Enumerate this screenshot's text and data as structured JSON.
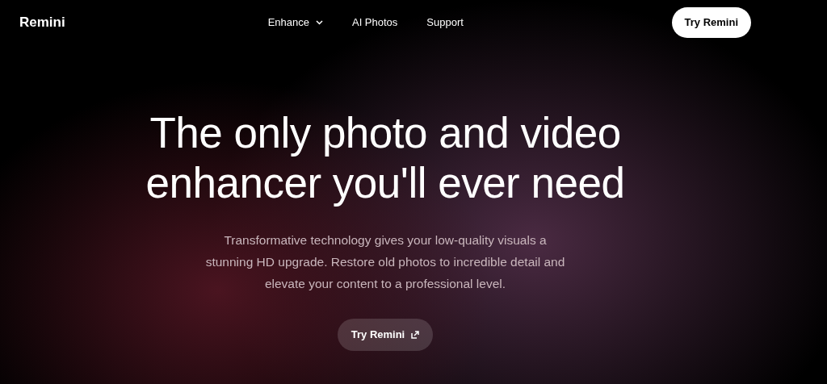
{
  "header": {
    "logo": "Remini",
    "nav": [
      {
        "label": "Enhance",
        "dropdown": true
      },
      {
        "label": "AI Photos",
        "dropdown": false
      },
      {
        "label": "Support",
        "dropdown": false
      }
    ],
    "cta": "Try Remini"
  },
  "hero": {
    "headline_lines": [
      "The only photo and video",
      "enhancer you'll ever need"
    ],
    "description_lines": [
      "Transformative technology gives your low-quality visuals a",
      "stunning HD upgrade. Restore old photos to incredible detail and",
      "elevate your content to a professional level."
    ],
    "button": {
      "label": "Try Remini",
      "external": true
    }
  }
}
